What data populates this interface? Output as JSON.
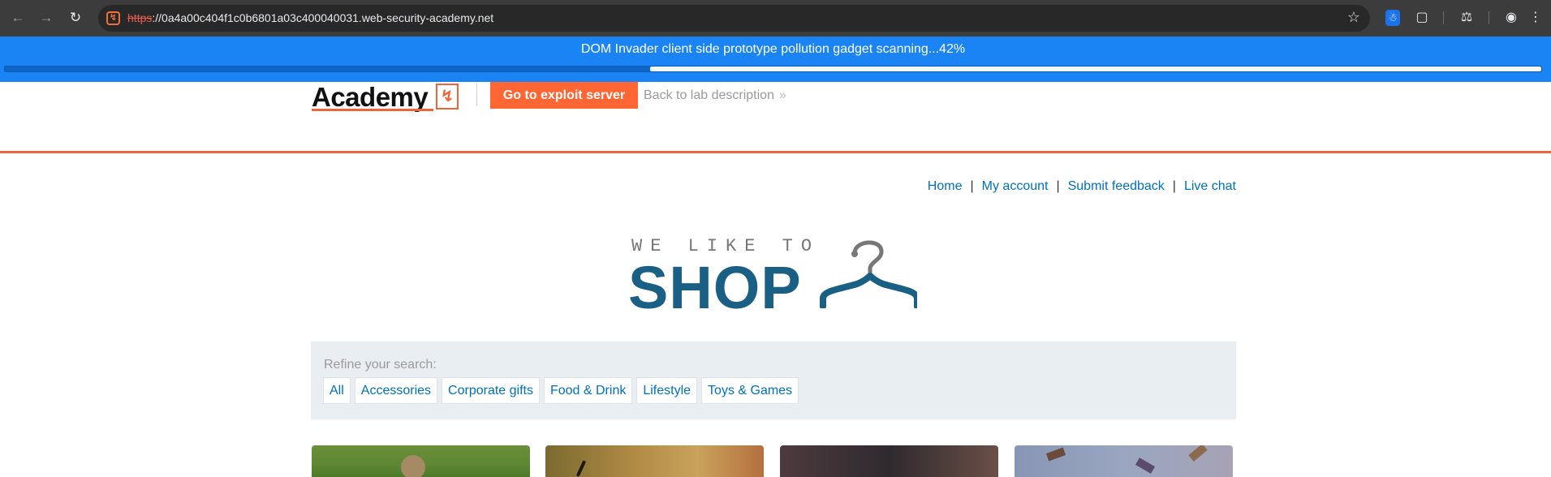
{
  "browser": {
    "url_scheme": "https",
    "url_rest": "://0a4a00c404f1c0b6801a03c400040031.web-security-academy.net",
    "icons": [
      "back-icon",
      "forward-icon",
      "reload-icon",
      "site-favicon",
      "bookmark-star-icon",
      "accessibility-extension-icon",
      "extensions-puzzle-icon",
      "labs-flask-icon",
      "profile-icon",
      "menu-dots-icon"
    ]
  },
  "banner": {
    "text": "DOM Invader client side prototype pollution gadget scanning...42%",
    "progress_percent": 42,
    "color": "#1a84f4"
  },
  "lab_header": {
    "academy_text": "Academy",
    "exploit_button": "Go to exploit server",
    "back_link": "Back to lab description",
    "back_chevron": "»",
    "accent_color": "#f0643c"
  },
  "topnav": {
    "items": [
      "Home",
      "My account",
      "Submit feedback",
      "Live chat"
    ],
    "separator": "|"
  },
  "logo": {
    "top_text": "WE LIKE TO",
    "main_text": "SHOP",
    "color": "#1a5f84"
  },
  "filter": {
    "label": "Refine your search:",
    "categories": [
      "All",
      "Accessories",
      "Corporate gifts",
      "Food & Drink",
      "Lifestyle",
      "Toys & Games"
    ]
  }
}
